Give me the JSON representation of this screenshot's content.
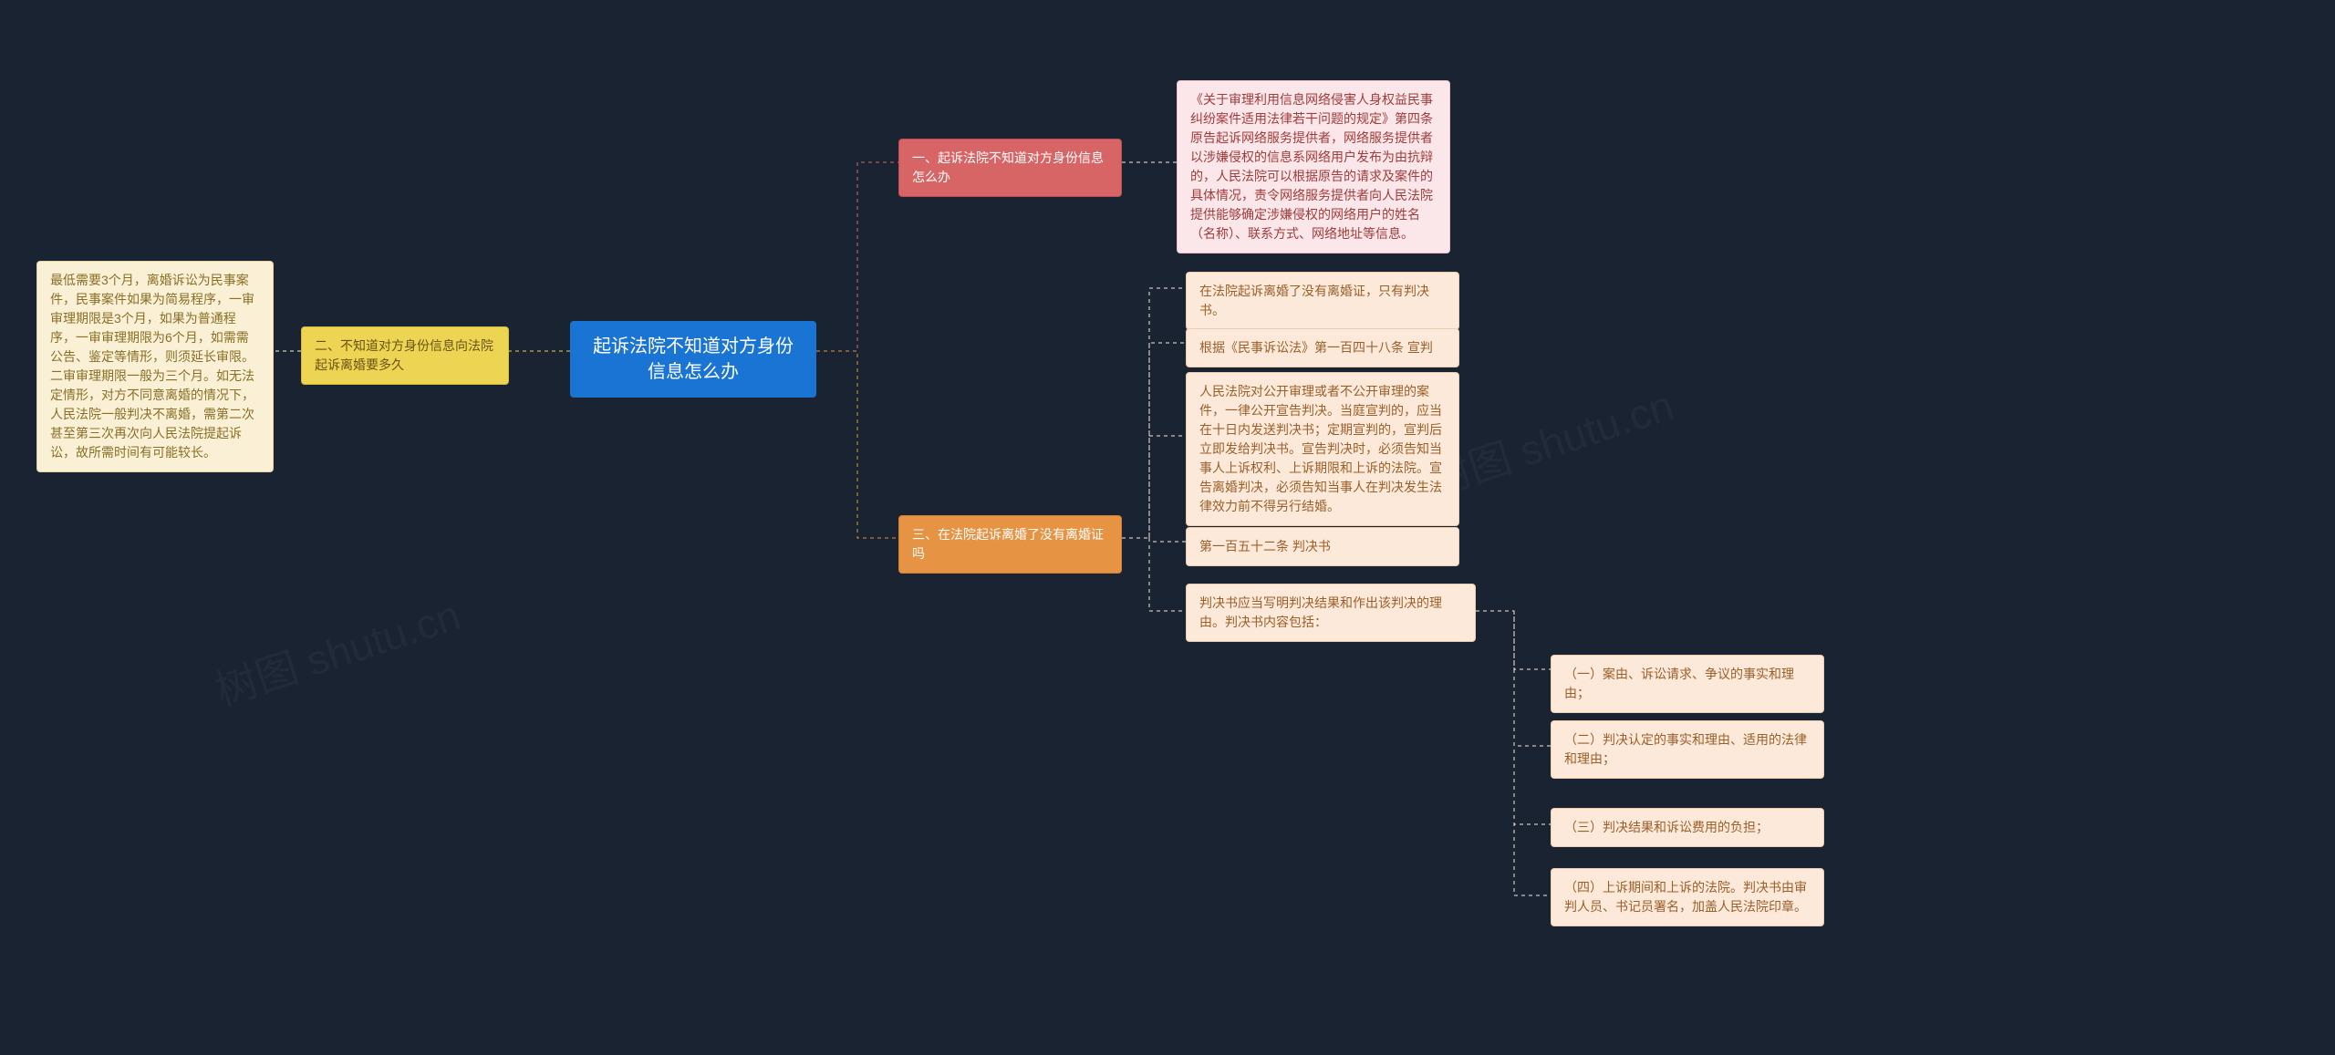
{
  "center": "起诉法院不知道对方身份信息怎么办",
  "left": {
    "branch": "二、不知道对方身份信息向法院起诉离婚要多久",
    "detail": "最低需要3个月，离婚诉讼为民事案件，民事案件如果为简易程序，一审审理期限是3个月，如果为普通程序，一审审理期限为6个月，如需需公告、鉴定等情形，则须延长审限。二审审理期限一般为三个月。如无法定情形，对方不同意离婚的情况下，人民法院一般判决不离婚，需第二次甚至第三次再次向人民法院提起诉讼，故所需时间有可能较长。"
  },
  "right1": {
    "branch": "一、起诉法院不知道对方身份信息怎么办",
    "detail": "《关于审理利用信息网络侵害人身权益民事纠纷案件适用法律若干问题的规定》第四条 原告起诉网络服务提供者，网络服务提供者以涉嫌侵权的信息系网络用户发布为由抗辩的，人民法院可以根据原告的请求及案件的具体情况，责令网络服务提供者向人民法院提供能够确定涉嫌侵权的网络用户的姓名（名称）、联系方式、网络地址等信息。"
  },
  "right3": {
    "branch": "三、在法院起诉离婚了没有离婚证吗",
    "items": [
      "在法院起诉离婚了没有离婚证，只有判决书。",
      "根据《民事诉讼法》第一百四十八条 宣判",
      "人民法院对公开审理或者不公开审理的案件，一律公开宣告判决。当庭宣判的，应当在十日内发送判决书；定期宣判的，宣判后立即发给判决书。宣告判决时，必须告知当事人上诉权利、上诉期限和上诉的法院。宣告离婚判决，必须告知当事人在判决发生法律效力前不得另行结婚。",
      "第一百五十二条 判决书",
      "判决书应当写明判决结果和作出该判决的理由。判决书内容包括："
    ],
    "sub": [
      "（一）案由、诉讼请求、争议的事实和理由；",
      "（二）判决认定的事实和理由、适用的法律和理由；",
      "（三）判决结果和诉讼费用的负担；",
      "（四）上诉期间和上诉的法院。判决书由审判人员、书记员署名，加盖人民法院印章。"
    ]
  },
  "watermarks": {
    "w1": "树图 shutu.cn",
    "w2": "树图 shutu.cn"
  }
}
